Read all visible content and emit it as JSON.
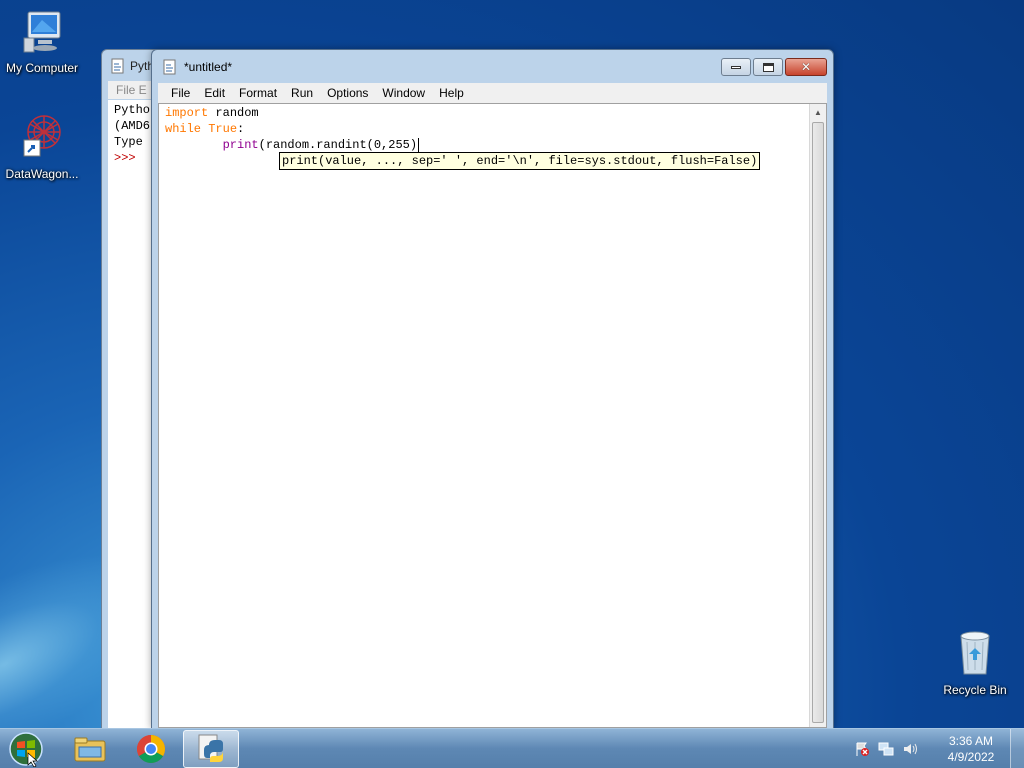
{
  "desktop": {
    "icons": [
      {
        "label": "My Computer"
      },
      {
        "label": "DataWagon..."
      },
      {
        "label": "Recycle Bin"
      }
    ]
  },
  "shell_window": {
    "title": "Pyth",
    "menu": "File   E",
    "lines": [
      "Pytho",
      "(AMD6",
      "Type "
    ],
    "prompt": ">>>"
  },
  "editor_window": {
    "title": "*untitled*",
    "menu": [
      "File",
      "Edit",
      "Format",
      "Run",
      "Options",
      "Window",
      "Help"
    ],
    "code": {
      "line1_kw": "import",
      "line1_rest": " random",
      "line2_kw1": "while",
      "line2_sp": " ",
      "line2_kw2": "True",
      "line2_rest": ":",
      "line3_indent": "        ",
      "line3_builtin": "print",
      "line3_rest": "(random.randint(0,255)"
    },
    "calltip": "print(value, ..., sep=' ', end='\\n', file=sys.stdout, flush=False)"
  },
  "taskbar": {
    "clock_time": "3:36 AM",
    "clock_date": "4/9/2022",
    "pinned": [
      "windows-explorer-icon",
      "chrome-icon",
      "python-idle-icon"
    ]
  }
}
